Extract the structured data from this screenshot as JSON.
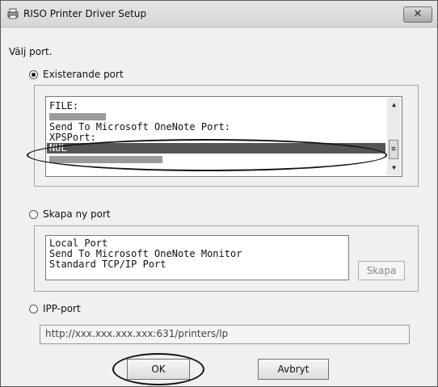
{
  "window": {
    "title": "RISO Printer Driver Setup",
    "close_glyph": "✕"
  },
  "prompt": "Välj port.",
  "existing_port": {
    "label": "Existerande port",
    "selected": true,
    "items": [
      "FILE:",
      "",
      "Send To Microsoft OneNote Port:",
      "XPSPort:",
      "NUL",
      ""
    ],
    "selected_item": "NUL"
  },
  "new_port": {
    "label": "Skapa ny port",
    "selected": false,
    "items": [
      "Local Port",
      "Send To Microsoft OneNote Monitor",
      "Standard TCP/IP Port"
    ],
    "create_button": "Skapa"
  },
  "ipp_port": {
    "label": "IPP-port",
    "selected": false,
    "url": "http://xxx.xxx.xxx.xxx:631/printers/lp"
  },
  "buttons": {
    "ok": "OK",
    "cancel": "Avbryt"
  },
  "colors": {
    "selection": "#555555",
    "annotation": "#111111"
  }
}
